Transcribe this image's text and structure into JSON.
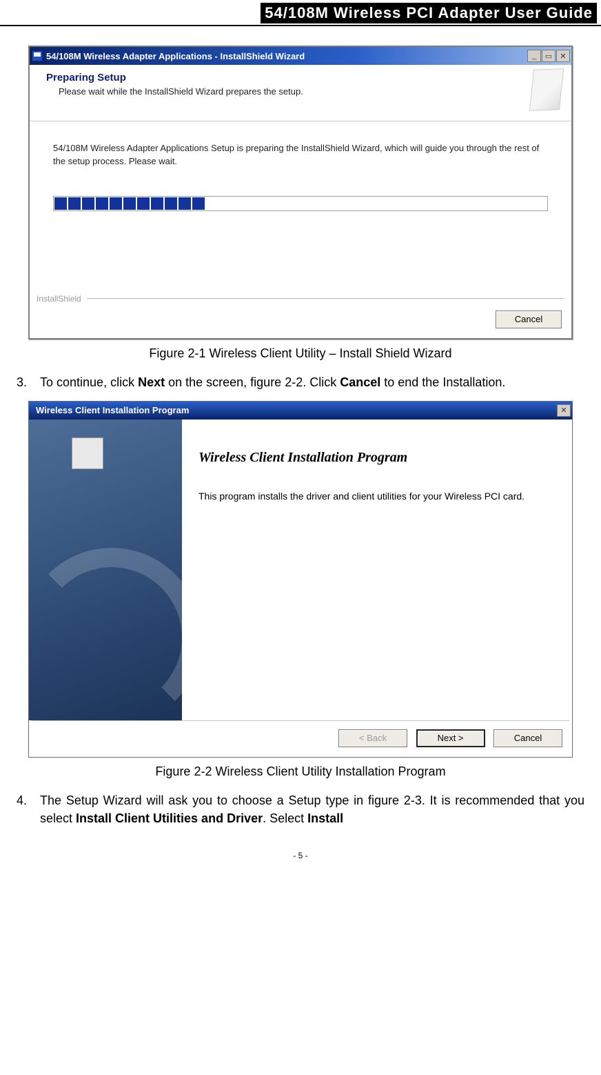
{
  "header": {
    "title": "54/108M Wireless PCI Adapter User Guide"
  },
  "figure1": {
    "window_title": "54/108M Wireless Adapter Applications - InstallShield Wizard",
    "prep_title": "Preparing Setup",
    "prep_subtitle": "Please wait while the InstallShield Wizard prepares the setup.",
    "body_text": "54/108M Wireless Adapter Applications Setup is preparing the InstallShield Wizard, which will guide you through the rest of the setup process. Please wait.",
    "progress_segments_on": 11,
    "progress_segments_total": 32,
    "installshield_label": "InstallShield",
    "cancel_label": "Cancel",
    "caption": "Figure 2-1    Wireless Client Utility – Install Shield Wizard"
  },
  "instruction3": {
    "number": "3.",
    "text_before_next": "To continue, click ",
    "next": "Next",
    "text_mid": " on the screen, figure 2-2. Click ",
    "cancel": "Cancel",
    "text_after": " to end the Installation."
  },
  "figure2": {
    "window_title": "Wireless Client Installation Program",
    "headline": "Wireless Client Installation Program",
    "body_text": "This program installs the driver and client utilities for your Wireless PCI card.",
    "back_label": "< Back",
    "next_label": "Next >",
    "cancel_label": "Cancel",
    "caption": "Figure 2-2    Wireless Client Utility Installation Program"
  },
  "instruction4": {
    "number": "4.",
    "text_a": "The Setup Wizard will ask you to choose a Setup type in figure 2-3. It is recommended that you select ",
    "bold_a": "Install Client Utilities and Driver",
    "text_b": ". Select ",
    "bold_b": "Install"
  },
  "footer": {
    "page": "- 5 -"
  },
  "icons": {
    "minimize": "_",
    "restore": "▭",
    "close": "✕"
  }
}
